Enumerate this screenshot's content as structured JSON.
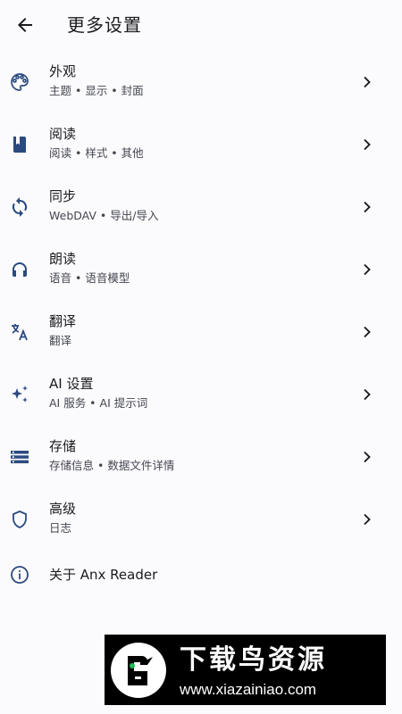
{
  "appbar": {
    "title": "更多设置",
    "back_icon": "arrow-back-icon"
  },
  "items": [
    {
      "label": "外观",
      "sub": "主题 • 显示 • 封面",
      "icon": "palette-icon"
    },
    {
      "label": "阅读",
      "sub": "阅读 • 样式 • 其他",
      "icon": "book-icon"
    },
    {
      "label": "同步",
      "sub": "WebDAV • 导出/导入",
      "icon": "sync-icon"
    },
    {
      "label": "朗读",
      "sub": "语音 • 语音模型",
      "icon": "headphones-icon"
    },
    {
      "label": "翻译",
      "sub": "翻译",
      "icon": "translate-icon"
    },
    {
      "label": "AI 设置",
      "sub": "AI 服务 • AI 提示词",
      "icon": "sparkle-icon"
    },
    {
      "label": "存储",
      "sub": "存储信息 • 数据文件详情",
      "icon": "storage-icon"
    },
    {
      "label": "高级",
      "sub": "日志",
      "icon": "shield-icon"
    }
  ],
  "about": {
    "label": "关于 Anx Reader",
    "icon": "info-icon"
  },
  "watermark": {
    "title": "下载鸟资源",
    "url": "www.xiazainiao.com"
  },
  "colors": {
    "icon": "#2b4a7f",
    "text": "#1b1b1f",
    "subtext": "#44464f",
    "background": "#fbfbfe"
  }
}
